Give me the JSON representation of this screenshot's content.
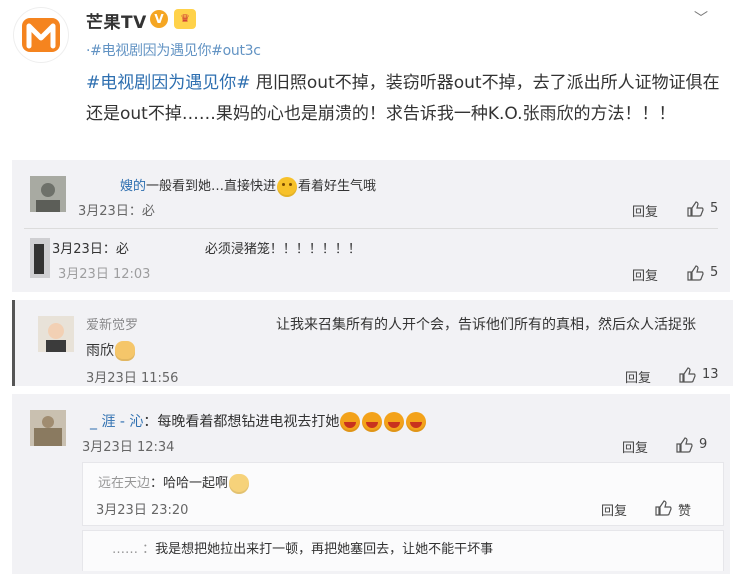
{
  "header": {
    "name": "芒果TV",
    "verified_icon": "verified-badge-icon",
    "vip_icon": "vip-badge-icon",
    "menu_icon": "chevron-down-icon",
    "garbled_line": "·#电视剧因为遇见你#out3c"
  },
  "post": {
    "hashtag": "#电视剧因为遇见你#",
    "text": " 甩旧照out不掉，装窃听器out不掉，去了派出所人证物证俱在还是out不掉……果妈的心也是崩溃的！求告诉我一种K.O.张雨欣的方法！！！"
  },
  "comments": [
    {
      "name": "嫂的",
      "text": "一般看到她…直接快进",
      "text_after": "看着好生气哦",
      "time": "3月23日",
      "time_suffix": "：必",
      "reply": "回复",
      "likes": "5"
    },
    {
      "name": "3月23日",
      "name_suffix": "：必",
      "text": "必须浸猪笼！！！！！！！",
      "time": "3月23日 12:03",
      "reply": "回复",
      "likes": "5"
    },
    {
      "name": "爱新觉罗",
      "text": "让我来召集所有的人开个会，告诉他们所有的真相，然后众人活捉张",
      "text_line2": "雨欣",
      "time": "3月23日 11:56",
      "reply": "回复",
      "likes": "13"
    },
    {
      "name": "_ 涯 - 沁",
      "text": "：每晚看着都想钻进电视去打她",
      "time": "3月23日 12:34",
      "reply": "回复",
      "likes": "9"
    },
    {
      "name": "远在天边",
      "text": "：哈哈一起啊",
      "time": "3月23日 23:20",
      "reply": "回复",
      "likes": "赞"
    },
    {
      "name": "…… ：",
      "text": "我是想把她拉出来打一顿，再把她塞回去，让她不能干坏事"
    }
  ],
  "colors": {
    "link": "#2e6fb0",
    "block_bg": "#f2f2f5",
    "logo_orange": "#f5841f"
  }
}
